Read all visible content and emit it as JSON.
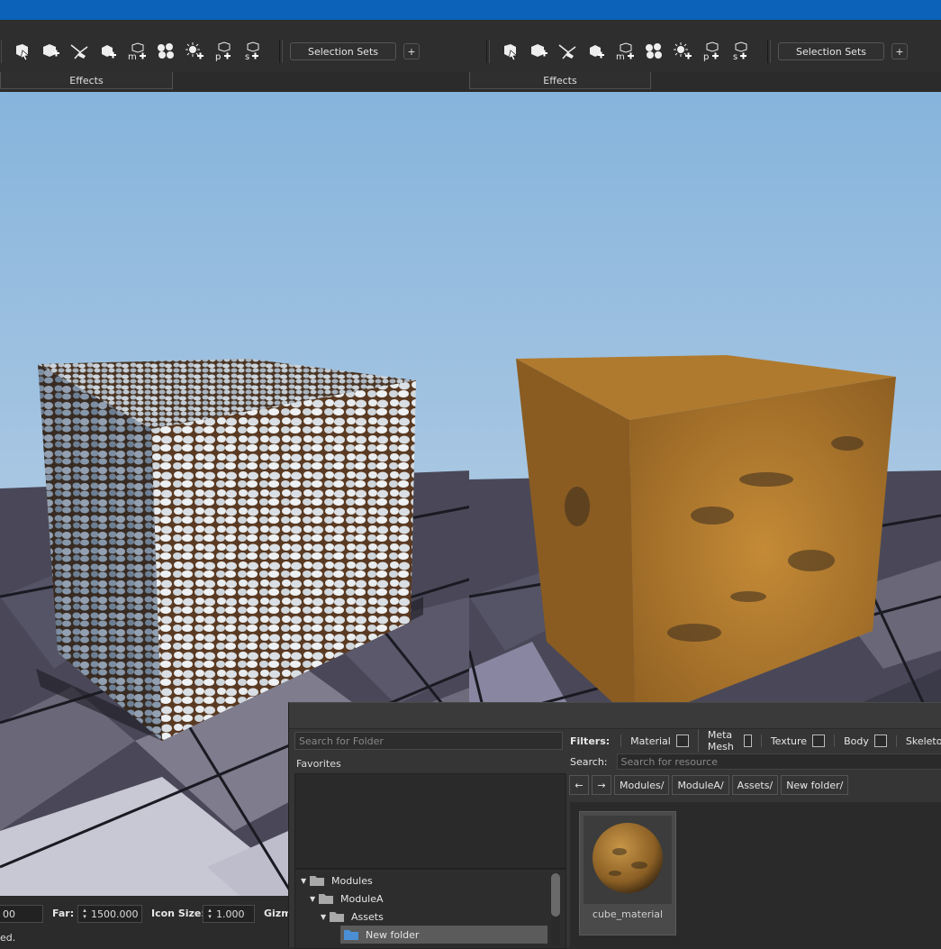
{
  "toolbar": {
    "selection_sets_label": "Selection Sets",
    "plus_label": "+",
    "effects_label": "Effects",
    "icons": [
      "select-cursor-icon",
      "add-box-icon",
      "paint-icon",
      "add-object-icon",
      "add-mesh-icon",
      "particle-icon",
      "add-light-icon",
      "add-prefab-icon",
      "add-sound-icon"
    ]
  },
  "viewport_bottom": {
    "near_value": "00",
    "far_label": "Far:",
    "far_value": "1500.000",
    "icon_size_label": "Icon Size:",
    "icon_size_value": "1.000",
    "gizmo_label": "Gizm",
    "status_text": "ed."
  },
  "browser": {
    "folder_search_placeholder": "Search for Folder",
    "favorites_label": "Favorites",
    "filters_label": "Filters:",
    "filters": [
      "Material",
      "Meta Mesh",
      "Texture",
      "Body",
      "Skeleton"
    ],
    "search_label": "Search:",
    "resource_search_placeholder": "Search for resource",
    "path": [
      "Modules/",
      "ModuleA/",
      "Assets/",
      "New folder/"
    ],
    "tree": [
      {
        "label": "Modules"
      },
      {
        "label": "ModuleA"
      },
      {
        "label": "Assets"
      },
      {
        "label": "New folder"
      }
    ],
    "resources": [
      {
        "label": "cube_material"
      }
    ]
  },
  "colors": {
    "titlebar": "#0b62b8",
    "panel": "#2e2e2e",
    "sky_top": "#8fbbe0",
    "sky_bottom": "#c9d9e9",
    "accent_folder": "#4a8fd6"
  }
}
